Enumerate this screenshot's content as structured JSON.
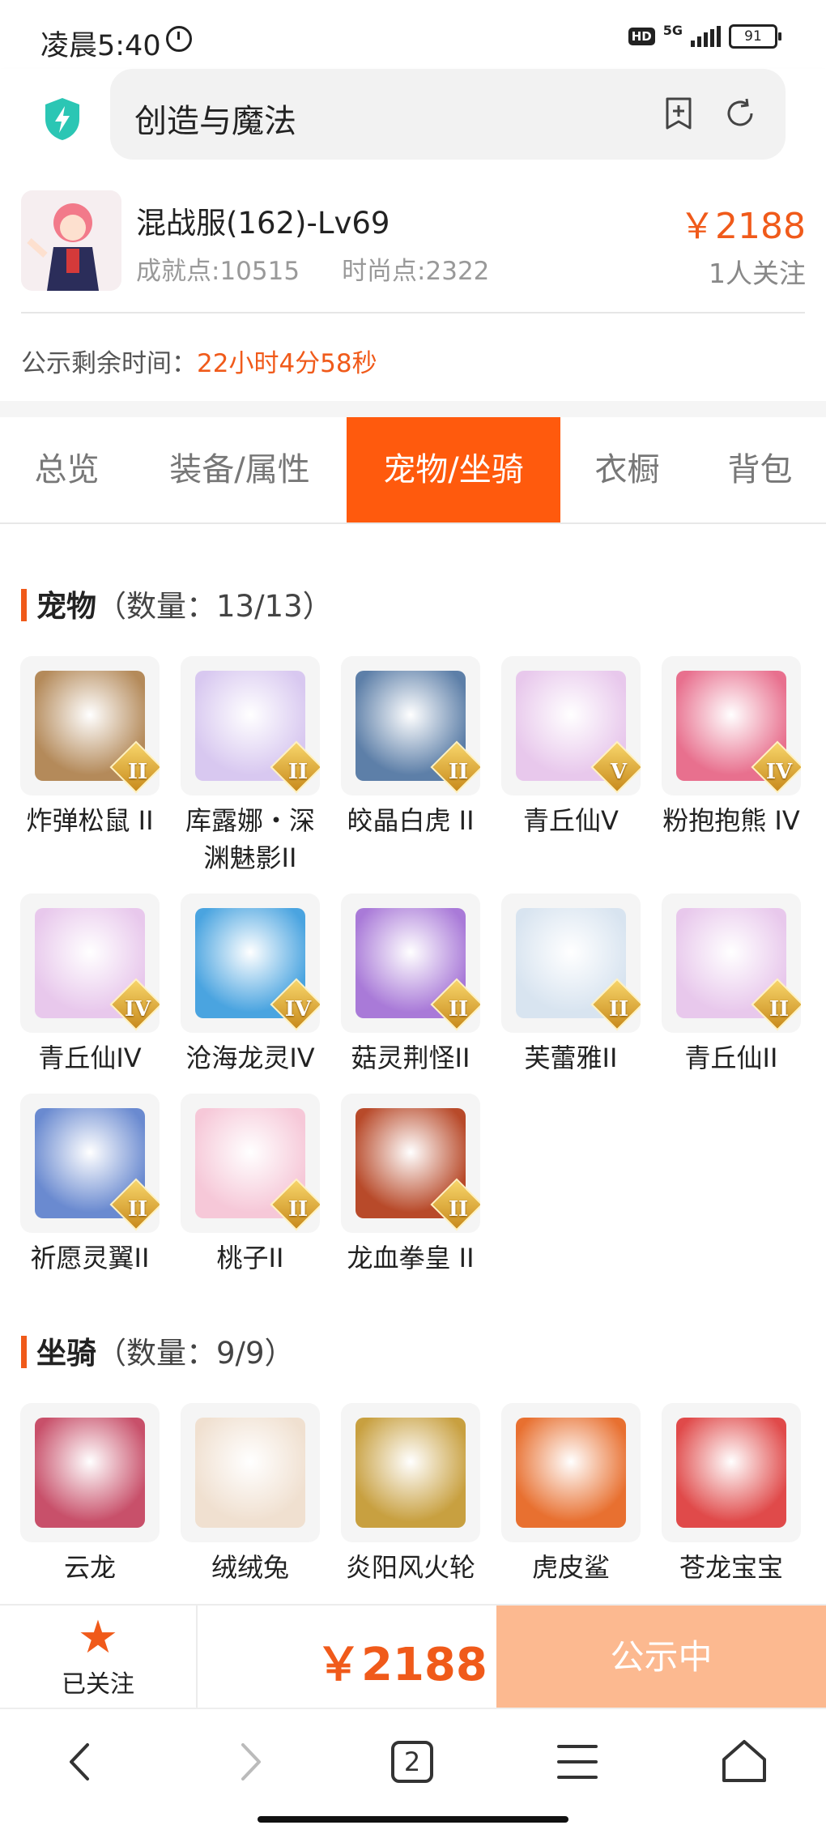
{
  "status_bar": {
    "time": "凌晨5:40",
    "hd": "HD",
    "network": "5G",
    "battery": "91"
  },
  "browser": {
    "search_text": "创造与魔法"
  },
  "item": {
    "title": "混战服(162)-Lv69",
    "achievement": "成就点:10515",
    "fashion": "时尚点:2322",
    "price": "￥2188",
    "followers": "1人关注",
    "countdown_label": "公示剩余时间：",
    "countdown_value": "22小时4分58秒"
  },
  "tabs": [
    {
      "label": "总览"
    },
    {
      "label": "装备/属性"
    },
    {
      "label": "宠物/坐骑",
      "active": true
    },
    {
      "label": "衣橱"
    },
    {
      "label": "背包"
    }
  ],
  "pets": {
    "title": "宠物",
    "count": "（数量：13/13）",
    "items": [
      {
        "label": "炸弹松鼠 II",
        "badge": "II",
        "icon": "squirrel-icon",
        "color": "#b48a5a"
      },
      {
        "label": "库露娜・深渊魅影II",
        "badge": "II",
        "icon": "kuluna-icon",
        "color": "#d8c8f0"
      },
      {
        "label": "皎晶白虎 II",
        "badge": "II",
        "icon": "white-tiger-icon",
        "color": "#5d7fa8"
      },
      {
        "label": "青丘仙V",
        "badge": "V",
        "icon": "qingqiu-icon",
        "color": "#e8c8ec"
      },
      {
        "label": "粉抱抱熊 IV",
        "badge": "IV",
        "icon": "pink-bear-icon",
        "color": "#e8708e"
      },
      {
        "label": "青丘仙IV",
        "badge": "IV",
        "icon": "qingqiu-icon",
        "color": "#e8c8ec"
      },
      {
        "label": "沧海龙灵IV",
        "badge": "IV",
        "icon": "sea-dragon-icon",
        "color": "#4aa4e0"
      },
      {
        "label": "菇灵荆怪II",
        "badge": "II",
        "icon": "mushroom-icon",
        "color": "#a97ad8"
      },
      {
        "label": "芙蕾雅II",
        "badge": "II",
        "icon": "freya-icon",
        "color": "#d8e4f0"
      },
      {
        "label": "青丘仙II",
        "badge": "II",
        "icon": "qingqiu-icon",
        "color": "#e8c8ec"
      },
      {
        "label": "祈愿灵翼II",
        "badge": "II",
        "icon": "wing-icon",
        "color": "#6a8ad0"
      },
      {
        "label": "桃子II",
        "badge": "II",
        "icon": "peach-cat-icon",
        "color": "#f6c8d8"
      },
      {
        "label": "龙血拳皇 II",
        "badge": "II",
        "icon": "dragon-boxer-icon",
        "color": "#b84a2a"
      }
    ]
  },
  "mounts": {
    "title": "坐骑",
    "count": "（数量：9/9）",
    "items": [
      {
        "label": "云龙",
        "icon": "cloud-dragon-icon",
        "color": "#c8506a"
      },
      {
        "label": "绒绒兔",
        "icon": "fluffy-rabbit-icon",
        "color": "#f0e0d0"
      },
      {
        "label": "炎阳风火轮",
        "icon": "fire-wheel-icon",
        "color": "#c8a040"
      },
      {
        "label": "虎皮鲨",
        "icon": "tiger-shark-icon",
        "color": "#e87030"
      },
      {
        "label": "苍龙宝宝",
        "icon": "baby-dragon-icon",
        "color": "#e04a4a"
      }
    ]
  },
  "action_bar": {
    "fav_label": "已关注",
    "price": "￥2188",
    "button_label": "公示中"
  },
  "nav": {
    "tab_count": "2"
  },
  "colors": {
    "accent": "#ff5a0d",
    "price": "#f05a1a",
    "button_disabled": "#fcb990"
  }
}
